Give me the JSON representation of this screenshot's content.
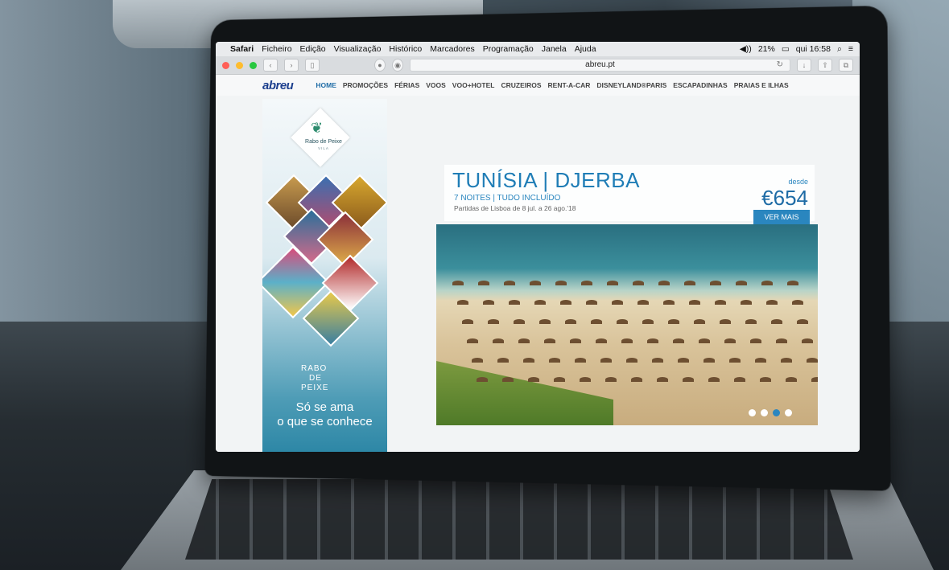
{
  "menubar": {
    "app_name": "Safari",
    "items": [
      "Ficheiro",
      "Edição",
      "Visualização",
      "Histórico",
      "Marcadores",
      "Programação",
      "Janela",
      "Ajuda"
    ],
    "battery": "21%",
    "clock": "qui 16:58"
  },
  "browser": {
    "url": "abreu.pt"
  },
  "site": {
    "logo": "abreu",
    "nav": [
      "HOME",
      "PROMOÇÕES",
      "FÉRIAS",
      "VOOS",
      "VOO+HOTEL",
      "CRUZEIROS",
      "RENT-A-CAR",
      "DISNEYLAND®PARIS",
      "ESCAPADINHAS",
      "PRAIAS E ILHAS"
    ],
    "active_nav": "HOME"
  },
  "ad": {
    "brand": "Rabo de Peixe",
    "brand_sub": "VILA",
    "title_lines": [
      "RABO",
      "DE",
      "PEIXE"
    ],
    "slogan_line1": "Só se ama",
    "slogan_line2": "o que se conhece"
  },
  "promo": {
    "title": "TUNÍSIA | DJERBA",
    "subtitle": "7 NOITES | TUDO INCLUÍDO",
    "dates": "Partidas de Lisboa de 8 jul. a 26 ago.'18",
    "from_label": "desde",
    "price": "€654",
    "cta": "VER MAIS"
  },
  "carousel": {
    "count": 4,
    "active_index": 2
  },
  "colors": {
    "accent": "#2a86bf",
    "logo": "#1c3f8e"
  }
}
